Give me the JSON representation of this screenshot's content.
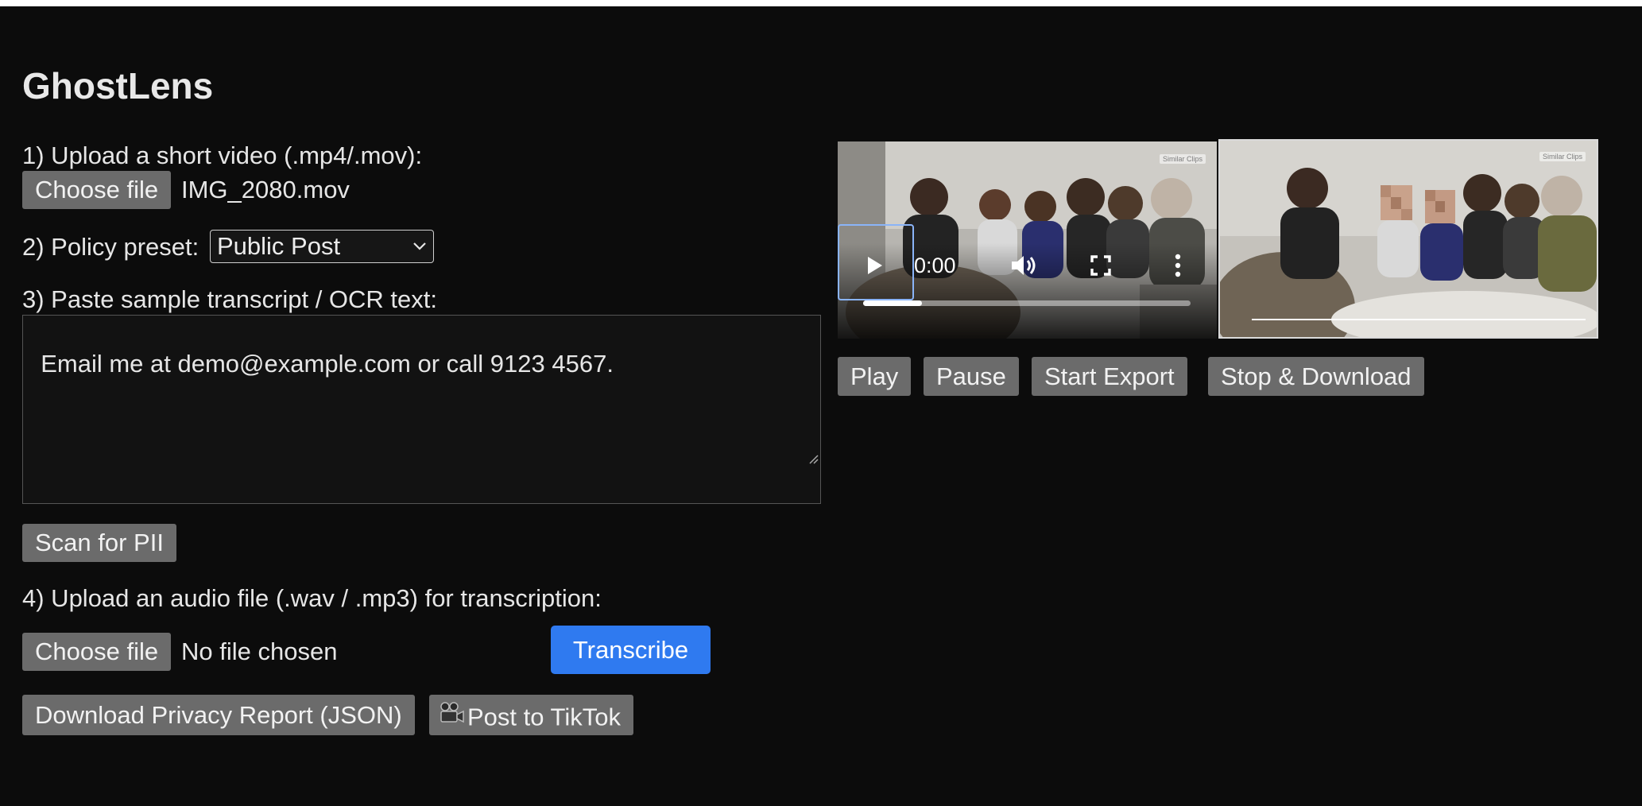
{
  "app": {
    "title": "GhostLens"
  },
  "step1": {
    "label": "1) Upload a short video (.mp4/.mov):",
    "choose_label": "Choose file",
    "filename": "IMG_2080.mov"
  },
  "step2": {
    "label": "2) Policy preset:",
    "selected": "Public Post"
  },
  "step3": {
    "label": "3) Paste sample transcript / OCR text:",
    "text": "Email me at demo@example.com or call 9123 4567.",
    "scan_label": "Scan for PII"
  },
  "step4": {
    "label": "4) Upload an audio file (.wav / .mp3) for transcription:",
    "choose_label": "Choose file",
    "filename": "No file chosen",
    "transcribe_label": "Transcribe"
  },
  "actions": {
    "report_label": "Download Privacy Report (JSON)",
    "tiktok_label": "Post to TikTok"
  },
  "player": {
    "time": "0:00",
    "progress": 0.18,
    "badge": "Similar Clips"
  },
  "processed": {
    "badge": "Similar Clips"
  },
  "controls": {
    "play": "Play",
    "pause": "Pause",
    "start_export": "Start Export",
    "stop_download": "Stop & Download"
  },
  "colors": {
    "background": "#0c0c0c",
    "button": "#6b6b6b",
    "primary": "#2f7af0"
  },
  "icons": {
    "play": "play-icon",
    "volume": "volume-icon",
    "fullscreen": "fullscreen-icon",
    "more": "more-vertical-icon",
    "camera": "movie-camera-icon"
  }
}
